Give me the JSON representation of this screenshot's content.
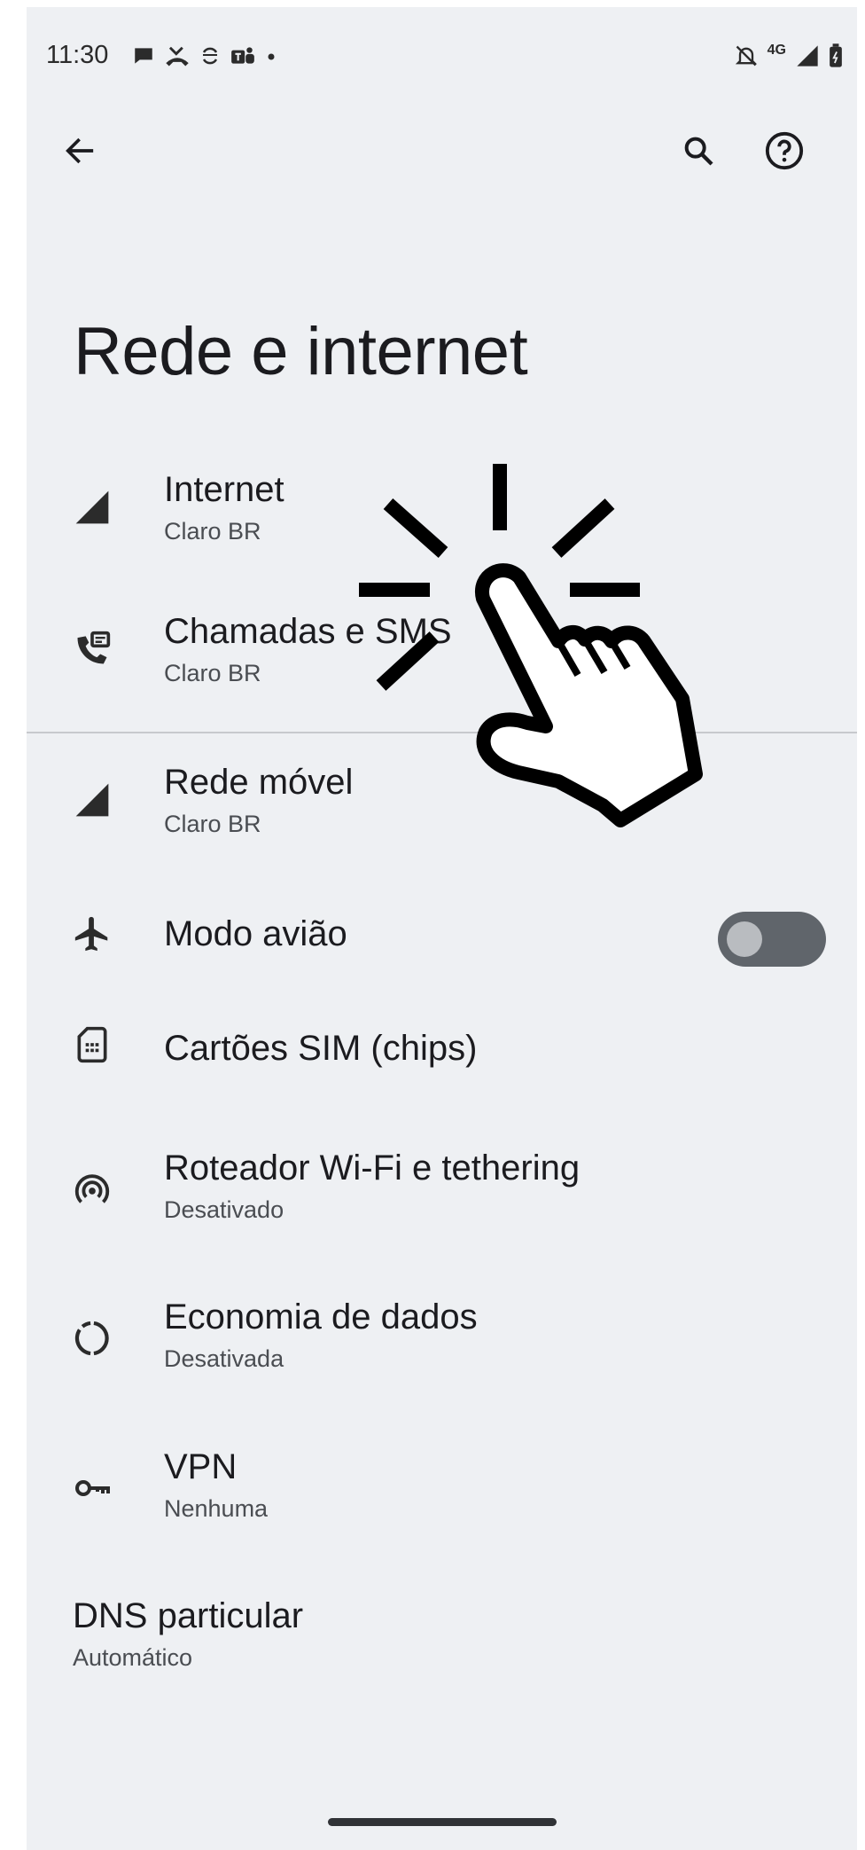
{
  "status_bar": {
    "time": "11:30",
    "network": "4G",
    "left_icons": [
      "chat-bubble-icon",
      "missed-call-icon",
      "sync-icon",
      "teams-icon",
      "dot-icon"
    ],
    "right_icons": [
      "notifications-off-icon",
      "signal-icon",
      "battery-icon"
    ]
  },
  "toolbar": {
    "back_icon": "arrow-back-icon",
    "search_icon": "search-icon",
    "help_icon": "help-icon"
  },
  "page": {
    "title": "Rede e internet"
  },
  "items": [
    {
      "title": "Internet",
      "subtitle": "Claro BR",
      "icon": "cell-signal-icon"
    },
    {
      "title": "Chamadas e SMS",
      "subtitle": "Claro BR",
      "icon": "calls-sms-icon"
    },
    {
      "title": "Rede móvel",
      "subtitle": "Claro BR",
      "icon": "cell-signal-icon"
    },
    {
      "title": "Modo avião",
      "icon": "airplane-icon",
      "toggle_on": false
    },
    {
      "title": "Cartões SIM (chips)",
      "icon": "sim-card-icon"
    },
    {
      "title": "Roteador Wi-Fi e tethering",
      "subtitle": "Desativado",
      "icon": "hotspot-icon"
    },
    {
      "title": "Economia de dados",
      "subtitle": "Desativada",
      "icon": "data-saver-icon"
    },
    {
      "title": "VPN",
      "subtitle": "Nenhuma",
      "icon": "vpn-key-icon"
    },
    {
      "title": "DNS particular",
      "subtitle": "Automático"
    }
  ],
  "overlay": {
    "icon": "tap-hand-icon"
  },
  "colors": {
    "background": "#eef0f3",
    "text": "#1b1b1f",
    "toggle_track": "#60656b"
  }
}
